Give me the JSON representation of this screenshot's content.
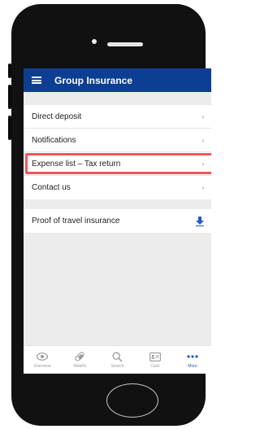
{
  "header": {
    "title": "Group Insurance"
  },
  "menu_group_1": [
    {
      "label": "Direct deposit"
    },
    {
      "label": "Notifications"
    },
    {
      "label": "Expense list – Tax return"
    },
    {
      "label": "Contact us"
    }
  ],
  "menu_group_2": [
    {
      "label": "Proof of travel insurance"
    }
  ],
  "chevron": "›",
  "tabs": [
    {
      "label": "Overview",
      "icon": "eye-icon"
    },
    {
      "label": "WebRx",
      "icon": "pill-icon"
    },
    {
      "label": "Search",
      "icon": "search-icon"
    },
    {
      "label": "Card",
      "icon": "card-icon"
    },
    {
      "label": "More",
      "icon": "more-icon"
    }
  ],
  "colors": {
    "appbar": "#0c3e93",
    "accent": "#1a5ccf",
    "highlight": "#f2555c"
  }
}
